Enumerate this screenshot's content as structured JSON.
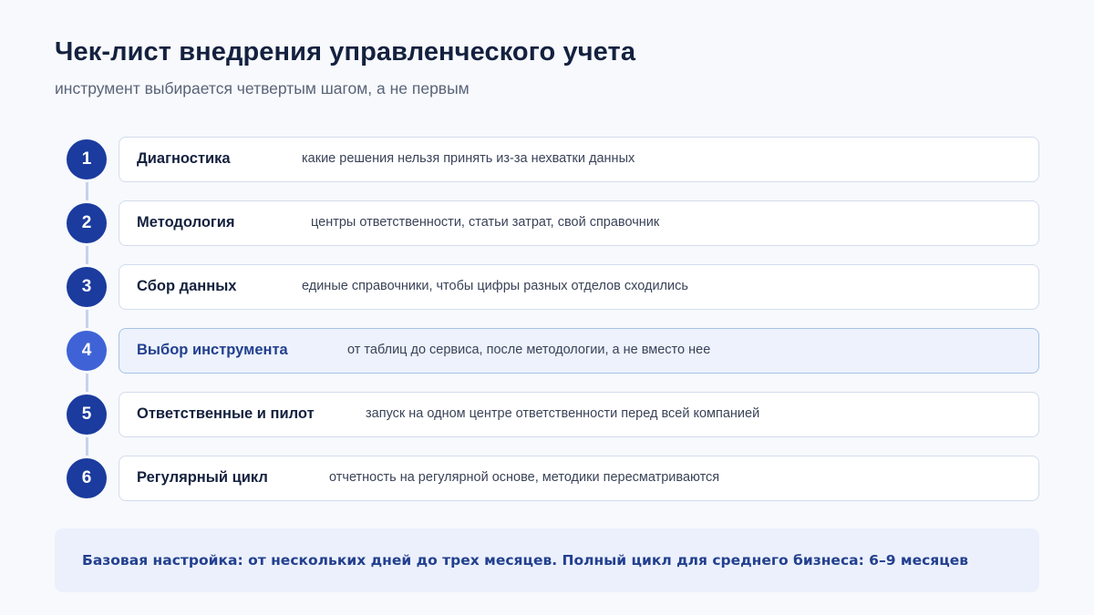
{
  "header": {
    "title": "Чек-лист внедрения управленческого учета",
    "subtitle": "инструмент выбирается четвертым шагом, а не первым"
  },
  "steps": [
    {
      "number": "1",
      "name": "Диагностика",
      "description": "какие решения нельзя принять из-за нехватки данных",
      "active": false
    },
    {
      "number": "2",
      "name": "Методология",
      "description": "центры ответственности, статьи затрат, свой справочник",
      "active": false
    },
    {
      "number": "3",
      "name": "Сбор данных",
      "description": "единые справочники, чтобы цифры разных отделов сходились",
      "active": false
    },
    {
      "number": "4",
      "name": "Выбор инструмента",
      "description": "от таблиц до сервиса, после методологии, а не вместо нее",
      "active": true
    },
    {
      "number": "5",
      "name": "Ответственные и пилот",
      "description": "запуск на одном центре ответственности перед всей компанией",
      "active": false
    },
    {
      "number": "6",
      "name": "Регулярный цикл",
      "description": "отчетность на регулярной основе, методики пересматриваются",
      "active": false
    }
  ],
  "footer": {
    "note": "Базовая настройка: от нескольких дней до трех месяцев. Полный цикл для среднего бизнеса: 6–9 месяцев"
  },
  "colors": {
    "step_circle": "#1b3b9e",
    "step_circle_active": "#3f63d6",
    "active_card_bg": "#edf2fd",
    "accent_text": "#23408f"
  }
}
